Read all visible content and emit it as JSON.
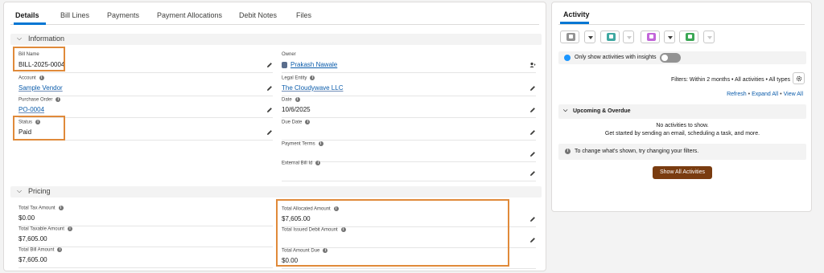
{
  "tabs": [
    "Details",
    "Bill Lines",
    "Payments",
    "Payment Allocations",
    "Debit Notes",
    "Files"
  ],
  "sections": {
    "information": "Information",
    "pricing": "Pricing"
  },
  "information": {
    "bill_name": {
      "label": "Bill Name",
      "value": "BILL-2025-0004"
    },
    "account": {
      "label": "Account",
      "value": "Sample Vendor"
    },
    "purchase_order": {
      "label": "Purchase Order",
      "value": "PO-0004"
    },
    "status": {
      "label": "Status",
      "value": "Paid"
    },
    "owner": {
      "label": "Owner",
      "value": "Prakash Nawale"
    },
    "legal_entity": {
      "label": "Legal Entity",
      "value": "The Cloudywave LLC"
    },
    "date": {
      "label": "Date",
      "value": "10/6/2025"
    },
    "due_date": {
      "label": "Due Date",
      "value": ""
    },
    "payment_terms": {
      "label": "Payment Terms",
      "value": ""
    },
    "external_bill_id": {
      "label": "External Bill Id",
      "value": ""
    }
  },
  "pricing": {
    "total_tax_amount": {
      "label": "Total Tax Amount",
      "value": "$0.00"
    },
    "total_taxable_amount": {
      "label": "Total Taxable Amount",
      "value": "$7,605.00"
    },
    "total_bill_amount": {
      "label": "Total Bill Amount",
      "value": "$7,605.00"
    },
    "total_allocated_amount": {
      "label": "Total Allocated Amount",
      "value": "$7,605.00"
    },
    "total_issued_debit_amount": {
      "label": "Total Issued Debit Amount",
      "value": ""
    },
    "total_amount_due": {
      "label": "Total Amount Due",
      "value": "$0.00"
    }
  },
  "activity": {
    "title": "Activity",
    "action_icons": [
      "email-icon",
      "log-call-icon",
      "event-icon",
      "task-icon"
    ],
    "icon_colors": {
      "email": "#939393",
      "call": "#3fa8a1",
      "event": "#c265d9",
      "task": "#3ba755"
    },
    "insights_label": "Only show activities with insights",
    "insights_on": false,
    "filters_text": "Filters: Within 2 months • All activities • All types",
    "links": [
      "Refresh",
      "Expand All",
      "View All"
    ],
    "upcoming_label": "Upcoming & Overdue",
    "no_activities": "No activities to show.",
    "get_started": "Get started by sending an email, scheduling a task, and more.",
    "change_filters": "To change what's shown, try changing your filters.",
    "show_all_button": "Show All Activities"
  }
}
